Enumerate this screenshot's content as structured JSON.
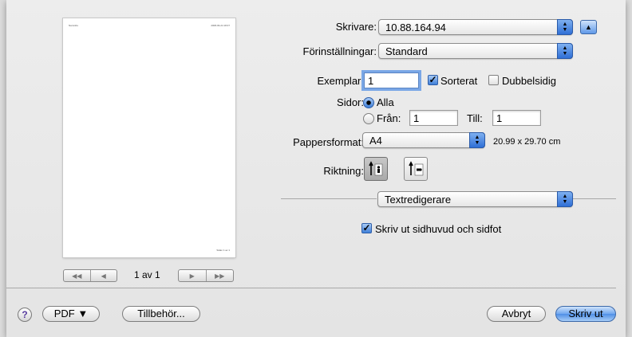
{
  "preview": {
    "header_left": "Namnlös",
    "header_right": "2008-09-24 18:07",
    "footer_right": "Sidan 1 av 1",
    "page_indicator": "1 av 1",
    "nav": {
      "first": "◀◀",
      "prev": "◀",
      "next": "▶",
      "last": "▶▶"
    }
  },
  "printer": {
    "label": "Skrivare:",
    "value": "10.88.164.94",
    "collapse_glyph": "▲"
  },
  "presets": {
    "label": "Förinställningar:",
    "value": "Standard"
  },
  "copies": {
    "label": "Exemplar:",
    "value": "1",
    "collated_label": "Sorterat",
    "collated": true,
    "duplex_label": "Dubbelsidig",
    "duplex": false
  },
  "pages": {
    "label": "Sidor:",
    "all_label": "Alla",
    "from_label": "Från:",
    "from_value": "1",
    "to_label": "Till:",
    "to_value": "1",
    "selected": "all"
  },
  "paper": {
    "label": "Pappersformat:",
    "value": "A4",
    "size_text": "20.99 x 29.70 cm"
  },
  "orientation": {
    "label": "Riktning:",
    "selected": "portrait"
  },
  "app_section": {
    "value": "Textredigerare"
  },
  "header_footer": {
    "label": "Skriv ut sidhuvud och sidfot",
    "checked": true
  },
  "bottom": {
    "help": "?",
    "pdf": "PDF ▼",
    "supplies": "Tillbehör...",
    "cancel": "Avbryt",
    "print": "Skriv ut"
  },
  "colors": {
    "accent": "#3f7fd8",
    "default_button": "#6fa6ef"
  }
}
